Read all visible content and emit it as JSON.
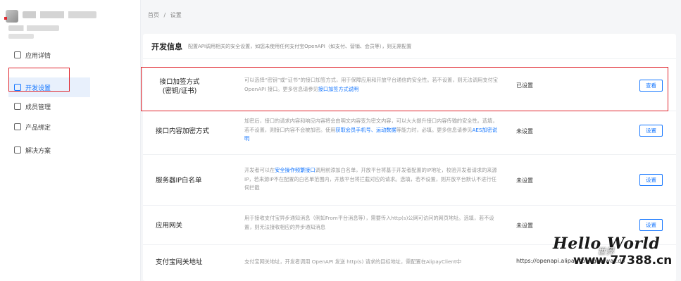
{
  "breadcrumb": {
    "home": "首页",
    "sep": "/",
    "current": "设置"
  },
  "sidebar": {
    "items": [
      {
        "label": "应用详情",
        "icon": "document-icon"
      },
      {
        "label": "开发设置",
        "icon": "settings-icon",
        "active": true
      },
      {
        "label": "成员管理",
        "icon": "users-icon"
      },
      {
        "label": "产品绑定",
        "icon": "product-icon"
      },
      {
        "label": "解决方案",
        "icon": "solution-icon"
      }
    ]
  },
  "panel": {
    "title": "开发信息",
    "desc": "配置API调用相关的安全设置，如您未使用任何支付宝OpenAPI（如支付、营销、会员等），则无需配置"
  },
  "rows": [
    {
      "label": "接口加签方式\n(密钥/证书)",
      "desc_pre": "可以选择“密钥”或“证书”的接口加签方式，用于保障应用和开放平台通信的安全性。若不设置，则无法调用支付宝 OpenAPI 接口。更多信息请参见",
      "desc_link": "接口加签方式说明",
      "status": "已设置",
      "button": "查看"
    },
    {
      "label": "接口内容加密方式",
      "desc_pre": "加密后，接口的请求内容和响应内容将会由明文内容变为密文内容，可以大大提升接口内容传输的安全性。选填，若不设置，则接口内容不会被加密。使用",
      "desc_link": "获取会员手机号、运动数据",
      "desc_post": "等能力时，必填。更多信息请参见",
      "desc_link2": "AES加密说明",
      "status": "未设置",
      "button": "设置"
    },
    {
      "label": "服务器IP白名单",
      "desc_pre": "开发者可以在",
      "desc_link": "安全操作频繁接口",
      "desc_post": "调用前添加白名单，开放平台将基于开发者配置的IP地址，校验开发者请求的来源IP，若来源IP不在配置的白名单范围内，开放平台将拦截对应的请求。选填，若不设置，则开放平台默认不进行任何拦截",
      "status": "未设置",
      "button": "设置"
    },
    {
      "label": "应用网关",
      "desc_pre": "用于接收支付宝异步通知消息（例如From平台消息等），需要传入http(s)公网可访问的网页地址。选填，若不设置，则无法接收相应的异步通知消息",
      "status": "未设置",
      "button": "设置"
    },
    {
      "label": "支付宝网关地址",
      "desc_pre": "支付宝网关地址，开发者调用 OpenAPI 发送 http(s) 请求的目标地址，需配置在AlipayClient中",
      "status": "https://openapi.alipay.com/gateway.do"
    }
  ],
  "watermark": {
    "title": "Hello World",
    "sub": "世界",
    "url": "www.77388.cn"
  },
  "colors": {
    "accent": "#1677ff",
    "highlight": "#e0262e"
  }
}
